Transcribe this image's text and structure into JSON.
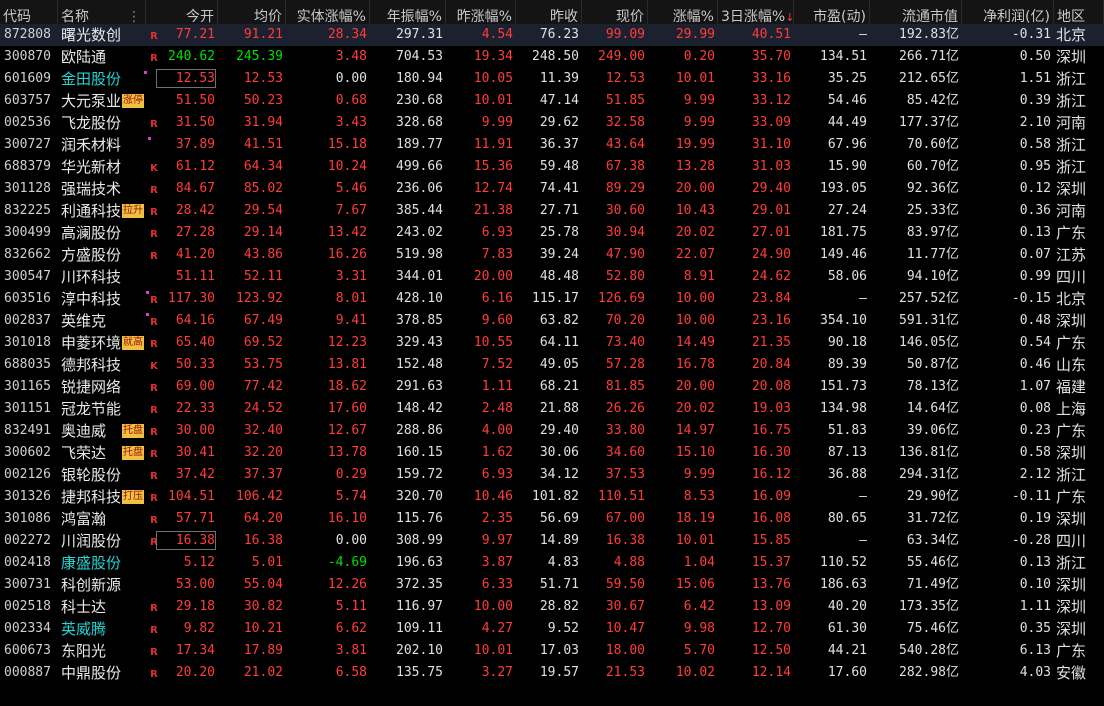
{
  "colors": {
    "up": "#ff3c3c",
    "down": "#00e000",
    "flat": "#e0e0e0",
    "name_highlight": "#22d4d4",
    "tag_bg": "#f0c040"
  },
  "icons": {
    "sort_indicator": "sort-desc-arrow-icon",
    "menu_indicator": "column-menu-dots-icon"
  },
  "headers": [
    {
      "key": "code",
      "label": "代码"
    },
    {
      "key": "name",
      "label": "名称"
    },
    {
      "key": "open",
      "label": "今开"
    },
    {
      "key": "avg",
      "label": "均价"
    },
    {
      "key": "body_pct",
      "label": "实体涨幅%"
    },
    {
      "key": "amp",
      "label": "年振幅%"
    },
    {
      "key": "prev_pct",
      "label": "昨涨幅%"
    },
    {
      "key": "prev_close",
      "label": "昨收"
    },
    {
      "key": "price",
      "label": "现价"
    },
    {
      "key": "chg",
      "label": "涨幅%"
    },
    {
      "key": "chg3",
      "label": "3日涨幅%"
    },
    {
      "key": "pe",
      "label": "市盈(动)"
    },
    {
      "key": "mcap",
      "label": "流通市值"
    },
    {
      "key": "np",
      "label": "净利润(亿)"
    },
    {
      "key": "region",
      "label": "地区"
    }
  ],
  "sort_column": "chg3",
  "rows": [
    {
      "code": "872808",
      "name": "曙光数创",
      "mark": "R",
      "open": "77.21",
      "avg": "91.21",
      "body_pct": "28.34",
      "amp": "297.31",
      "prev_pct": "4.54",
      "prev_close": "76.23",
      "price": "99.09",
      "chg": "29.99",
      "chg3": "40.51",
      "pe": "–",
      "mcap": "192.83亿",
      "np": "-0.31",
      "region": "北京"
    },
    {
      "code": "300870",
      "name": "欧陆通",
      "mark": "R",
      "open": "240.62",
      "avg": "245.39",
      "body_pct": "3.48",
      "amp": "704.53",
      "prev_pct": "19.34",
      "prev_close": "248.50",
      "price": "249.00",
      "chg": "0.20",
      "chg3": "35.70",
      "pe": "134.51",
      "mcap": "266.71亿",
      "np": "0.50",
      "region": "深圳"
    },
    {
      "code": "601609",
      "name": "金田股份",
      "mark": "",
      "open": "12.53",
      "avg": "12.53",
      "body_pct": "0.00",
      "amp": "180.94",
      "prev_pct": "10.05",
      "prev_close": "11.39",
      "price": "12.53",
      "chg": "10.01",
      "chg3": "33.16",
      "pe": "35.25",
      "mcap": "212.65亿",
      "np": "1.51",
      "region": "浙江"
    },
    {
      "code": "603757",
      "name": "大元泵业",
      "mark": "",
      "tag": "涨停",
      "open": "51.50",
      "avg": "50.23",
      "body_pct": "0.68",
      "amp": "230.68",
      "prev_pct": "10.01",
      "prev_close": "47.14",
      "price": "51.85",
      "chg": "9.99",
      "chg3": "33.12",
      "pe": "54.46",
      "mcap": "85.42亿",
      "np": "0.39",
      "region": "浙江"
    },
    {
      "code": "002536",
      "name": "飞龙股份",
      "mark": "R",
      "open": "31.50",
      "avg": "31.94",
      "body_pct": "3.43",
      "amp": "328.68",
      "prev_pct": "9.99",
      "prev_close": "29.62",
      "price": "32.58",
      "chg": "9.99",
      "chg3": "33.09",
      "pe": "44.49",
      "mcap": "177.37亿",
      "np": "2.10",
      "region": "河南"
    },
    {
      "code": "300727",
      "name": "润禾材料",
      "mark": "",
      "open": "37.89",
      "avg": "41.51",
      "body_pct": "15.18",
      "amp": "189.77",
      "prev_pct": "11.91",
      "prev_close": "36.37",
      "price": "43.64",
      "chg": "19.99",
      "chg3": "31.10",
      "pe": "67.96",
      "mcap": "70.60亿",
      "np": "0.58",
      "region": "浙江"
    },
    {
      "code": "688379",
      "name": "华光新材",
      "mark": "K",
      "open": "61.12",
      "avg": "64.34",
      "body_pct": "10.24",
      "amp": "499.66",
      "prev_pct": "15.36",
      "prev_close": "59.48",
      "price": "67.38",
      "chg": "13.28",
      "chg3": "31.03",
      "pe": "15.90",
      "mcap": "60.70亿",
      "np": "0.95",
      "region": "浙江"
    },
    {
      "code": "301128",
      "name": "强瑞技术",
      "mark": "R",
      "open": "84.67",
      "avg": "85.02",
      "body_pct": "5.46",
      "amp": "236.06",
      "prev_pct": "12.74",
      "prev_close": "74.41",
      "price": "89.29",
      "chg": "20.00",
      "chg3": "29.40",
      "pe": "193.05",
      "mcap": "92.36亿",
      "np": "0.12",
      "region": "深圳"
    },
    {
      "code": "832225",
      "name": "利通科技",
      "mark": "R",
      "tag": "拉升",
      "open": "28.42",
      "avg": "29.54",
      "body_pct": "7.67",
      "amp": "385.44",
      "prev_pct": "21.38",
      "prev_close": "27.71",
      "price": "30.60",
      "chg": "10.43",
      "chg3": "29.01",
      "pe": "27.24",
      "mcap": "25.33亿",
      "np": "0.36",
      "region": "河南"
    },
    {
      "code": "300499",
      "name": "高澜股份",
      "mark": "R",
      "open": "27.28",
      "avg": "29.14",
      "body_pct": "13.42",
      "amp": "243.02",
      "prev_pct": "6.93",
      "prev_close": "25.78",
      "price": "30.94",
      "chg": "20.02",
      "chg3": "27.01",
      "pe": "181.75",
      "mcap": "83.97亿",
      "np": "0.13",
      "region": "广东"
    },
    {
      "code": "832662",
      "name": "方盛股份",
      "mark": "R",
      "open": "41.20",
      "avg": "43.86",
      "body_pct": "16.26",
      "amp": "519.98",
      "prev_pct": "7.83",
      "prev_close": "39.24",
      "price": "47.90",
      "chg": "22.07",
      "chg3": "24.90",
      "pe": "149.46",
      "mcap": "11.77亿",
      "np": "0.07",
      "region": "江苏"
    },
    {
      "code": "300547",
      "name": "川环科技",
      "mark": "",
      "open": "51.11",
      "avg": "52.11",
      "body_pct": "3.31",
      "amp": "344.01",
      "prev_pct": "20.00",
      "prev_close": "48.48",
      "price": "52.80",
      "chg": "8.91",
      "chg3": "24.62",
      "pe": "58.06",
      "mcap": "94.10亿",
      "np": "0.99",
      "region": "四川"
    },
    {
      "code": "603516",
      "name": "淳中科技",
      "mark": "R",
      "open": "117.30",
      "avg": "123.92",
      "body_pct": "8.01",
      "amp": "428.10",
      "prev_pct": "6.16",
      "prev_close": "115.17",
      "price": "126.69",
      "chg": "10.00",
      "chg3": "23.84",
      "pe": "–",
      "mcap": "257.52亿",
      "np": "-0.15",
      "region": "北京"
    },
    {
      "code": "002837",
      "name": "英维克",
      "mark": "R",
      "open": "64.16",
      "avg": "67.49",
      "body_pct": "9.41",
      "amp": "378.85",
      "prev_pct": "9.60",
      "prev_close": "63.82",
      "price": "70.20",
      "chg": "10.00",
      "chg3": "23.16",
      "pe": "354.10",
      "mcap": "591.31亿",
      "np": "0.48",
      "region": "深圳"
    },
    {
      "code": "301018",
      "name": "申菱环境",
      "mark": "R",
      "tag": "就高",
      "open": "65.40",
      "avg": "69.52",
      "body_pct": "12.23",
      "amp": "329.43",
      "prev_pct": "10.55",
      "prev_close": "64.11",
      "price": "73.40",
      "chg": "14.49",
      "chg3": "21.35",
      "pe": "90.18",
      "mcap": "146.05亿",
      "np": "0.54",
      "region": "广东"
    },
    {
      "code": "688035",
      "name": "德邦科技",
      "mark": "K",
      "open": "50.33",
      "avg": "53.75",
      "body_pct": "13.81",
      "amp": "152.48",
      "prev_pct": "7.52",
      "prev_close": "49.05",
      "price": "57.28",
      "chg": "16.78",
      "chg3": "20.84",
      "pe": "89.39",
      "mcap": "50.87亿",
      "np": "0.46",
      "region": "山东"
    },
    {
      "code": "301165",
      "name": "锐捷网络",
      "mark": "R",
      "open": "69.00",
      "avg": "77.42",
      "body_pct": "18.62",
      "amp": "291.63",
      "prev_pct": "1.11",
      "prev_close": "68.21",
      "price": "81.85",
      "chg": "20.00",
      "chg3": "20.08",
      "pe": "151.73",
      "mcap": "78.13亿",
      "np": "1.07",
      "region": "福建"
    },
    {
      "code": "301151",
      "name": "冠龙节能",
      "mark": "R",
      "open": "22.33",
      "avg": "24.52",
      "body_pct": "17.60",
      "amp": "148.42",
      "prev_pct": "2.48",
      "prev_close": "21.88",
      "price": "26.26",
      "chg": "20.02",
      "chg3": "19.03",
      "pe": "134.98",
      "mcap": "14.64亿",
      "np": "0.08",
      "region": "上海"
    },
    {
      "code": "832491",
      "name": "奥迪威",
      "mark": "R",
      "tag": "托盘",
      "open": "30.00",
      "avg": "32.40",
      "body_pct": "12.67",
      "amp": "288.86",
      "prev_pct": "4.00",
      "prev_close": "29.40",
      "price": "33.80",
      "chg": "14.97",
      "chg3": "16.75",
      "pe": "51.83",
      "mcap": "39.06亿",
      "np": "0.23",
      "region": "广东"
    },
    {
      "code": "300602",
      "name": "飞荣达",
      "mark": "R",
      "tag": "托盘",
      "open": "30.41",
      "avg": "32.20",
      "body_pct": "13.78",
      "amp": "160.15",
      "prev_pct": "1.62",
      "prev_close": "30.06",
      "price": "34.60",
      "chg": "15.10",
      "chg3": "16.30",
      "pe": "87.13",
      "mcap": "136.81亿",
      "np": "0.58",
      "region": "深圳"
    },
    {
      "code": "002126",
      "name": "银轮股份",
      "mark": "R",
      "open": "37.42",
      "avg": "37.37",
      "body_pct": "0.29",
      "amp": "159.72",
      "prev_pct": "6.93",
      "prev_close": "34.12",
      "price": "37.53",
      "chg": "9.99",
      "chg3": "16.12",
      "pe": "36.88",
      "mcap": "294.31亿",
      "np": "2.12",
      "region": "浙江"
    },
    {
      "code": "301326",
      "name": "捷邦科技",
      "mark": "R",
      "tag": "打压",
      "open": "104.51",
      "avg": "106.42",
      "body_pct": "5.74",
      "amp": "320.70",
      "prev_pct": "10.46",
      "prev_close": "101.82",
      "price": "110.51",
      "chg": "8.53",
      "chg3": "16.09",
      "pe": "–",
      "mcap": "29.90亿",
      "np": "-0.11",
      "region": "广东"
    },
    {
      "code": "301086",
      "name": "鸿富瀚",
      "mark": "R",
      "open": "57.71",
      "avg": "64.20",
      "body_pct": "16.10",
      "amp": "115.76",
      "prev_pct": "2.35",
      "prev_close": "56.69",
      "price": "67.00",
      "chg": "18.19",
      "chg3": "16.08",
      "pe": "80.65",
      "mcap": "31.72亿",
      "np": "0.19",
      "region": "深圳"
    },
    {
      "code": "002272",
      "name": "川润股份",
      "mark": "R",
      "open": "16.38",
      "avg": "16.38",
      "body_pct": "0.00",
      "amp": "308.99",
      "prev_pct": "9.97",
      "prev_close": "14.89",
      "price": "16.38",
      "chg": "10.01",
      "chg3": "15.85",
      "pe": "–",
      "mcap": "63.34亿",
      "np": "-0.28",
      "region": "四川"
    },
    {
      "code": "002418",
      "name": "康盛股份",
      "mark": "",
      "open": "5.12",
      "avg": "5.01",
      "body_pct": "-4.69",
      "amp": "196.63",
      "prev_pct": "3.87",
      "prev_close": "4.83",
      "price": "4.88",
      "chg": "1.04",
      "chg3": "15.37",
      "pe": "110.52",
      "mcap": "55.46亿",
      "np": "0.13",
      "region": "浙江"
    },
    {
      "code": "300731",
      "name": "科创新源",
      "mark": "",
      "open": "53.00",
      "avg": "55.04",
      "body_pct": "12.26",
      "amp": "372.35",
      "prev_pct": "6.33",
      "prev_close": "51.71",
      "price": "59.50",
      "chg": "15.06",
      "chg3": "13.76",
      "pe": "186.63",
      "mcap": "71.49亿",
      "np": "0.10",
      "region": "深圳"
    },
    {
      "code": "002518",
      "name": "科士达",
      "mark": "R",
      "open": "29.18",
      "avg": "30.82",
      "body_pct": "5.11",
      "amp": "116.97",
      "prev_pct": "10.00",
      "prev_close": "28.82",
      "price": "30.67",
      "chg": "6.42",
      "chg3": "13.09",
      "pe": "40.20",
      "mcap": "173.35亿",
      "np": "1.11",
      "region": "深圳"
    },
    {
      "code": "002334",
      "name": "英威腾",
      "mark": "R",
      "open": "9.82",
      "avg": "10.21",
      "body_pct": "6.62",
      "amp": "109.11",
      "prev_pct": "4.27",
      "prev_close": "9.52",
      "price": "10.47",
      "chg": "9.98",
      "chg3": "12.70",
      "pe": "61.30",
      "mcap": "75.46亿",
      "np": "0.35",
      "region": "深圳"
    },
    {
      "code": "600673",
      "name": "东阳光",
      "mark": "R",
      "open": "17.34",
      "avg": "17.89",
      "body_pct": "3.81",
      "amp": "202.10",
      "prev_pct": "10.01",
      "prev_close": "17.03",
      "price": "18.00",
      "chg": "5.70",
      "chg3": "12.50",
      "pe": "44.21",
      "mcap": "540.28亿",
      "np": "6.13",
      "region": "广东"
    },
    {
      "code": "000887",
      "name": "中鼎股份",
      "mark": "R",
      "open": "20.20",
      "avg": "21.02",
      "body_pct": "6.58",
      "amp": "135.75",
      "prev_pct": "3.27",
      "prev_close": "19.57",
      "price": "21.53",
      "chg": "10.02",
      "chg3": "12.14",
      "pe": "17.60",
      "mcap": "282.98亿",
      "np": "4.03",
      "region": "安徽"
    }
  ]
}
